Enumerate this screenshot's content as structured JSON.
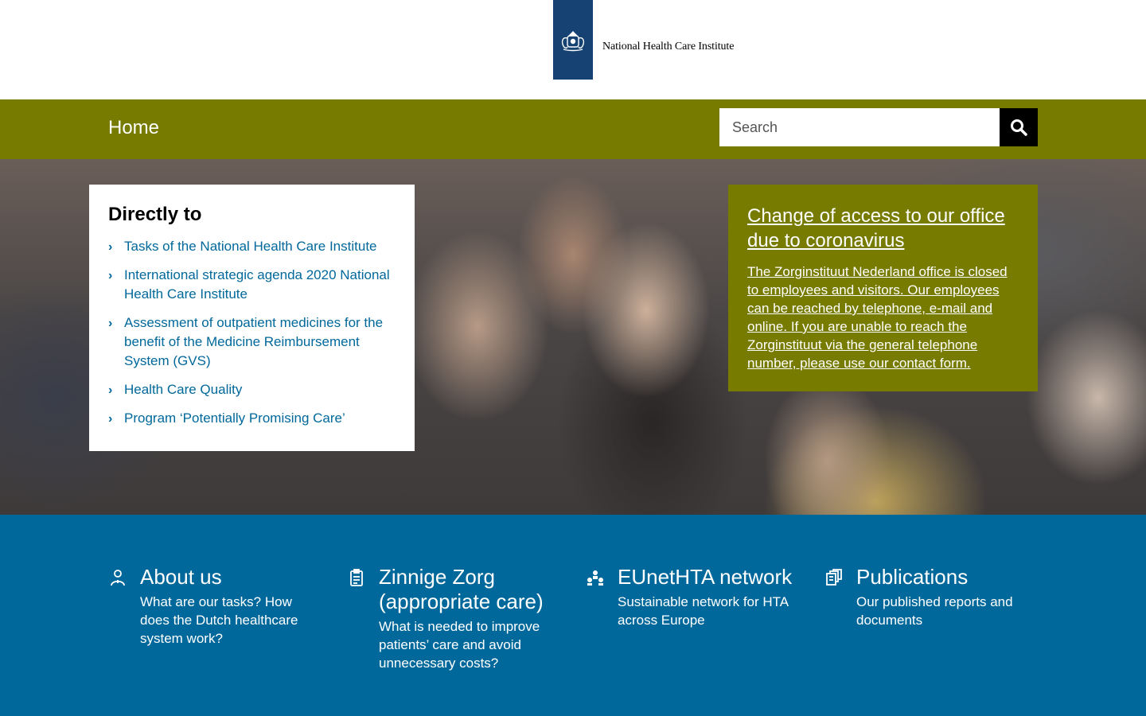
{
  "header": {
    "logo_text": "National Health Care Institute"
  },
  "nav": {
    "home_label": "Home"
  },
  "search": {
    "placeholder": "Search",
    "value": ""
  },
  "directly": {
    "title": "Directly to",
    "items": [
      {
        "label": "Tasks of the National Health Care Institute"
      },
      {
        "label": "International strategic agenda 2020 National Health Care Institute"
      },
      {
        "label": "Assessment of outpatient medicines for the benefit of the Medicine Reimbursement System (GVS)"
      },
      {
        "label": "Health Care Quality"
      },
      {
        "label": "Program ‘Potentially Promising Care’"
      }
    ]
  },
  "notice": {
    "title": "Change of access to our office due to coronavirus",
    "text": "The Zorginstituut Nederland office is closed to employees and visitors. Our employees can be reached by telephone, e-mail and online. If you are unable to reach the Zorginstituut via the general telephone number, please use our contact form."
  },
  "tiles": [
    {
      "icon": "person-icon",
      "title": "About us",
      "desc": "What are our tasks? How does the Dutch healthcare system work?"
    },
    {
      "icon": "clipboard-icon",
      "title": "Zinnige Zorg (appropriate care)",
      "desc": "What is needed to improve patients’ care and avoid unnecessary costs?"
    },
    {
      "icon": "network-icon",
      "title": "EUnetHTA network",
      "desc": "Sustainable network for HTA across Europe"
    },
    {
      "icon": "publications-icon",
      "title": "Publications",
      "desc": "Our published reports and documents"
    }
  ],
  "colors": {
    "brand_olive": "#777b00",
    "brand_blue": "#01689b",
    "logo_blue": "#154273",
    "link_blue": "#01689b"
  }
}
